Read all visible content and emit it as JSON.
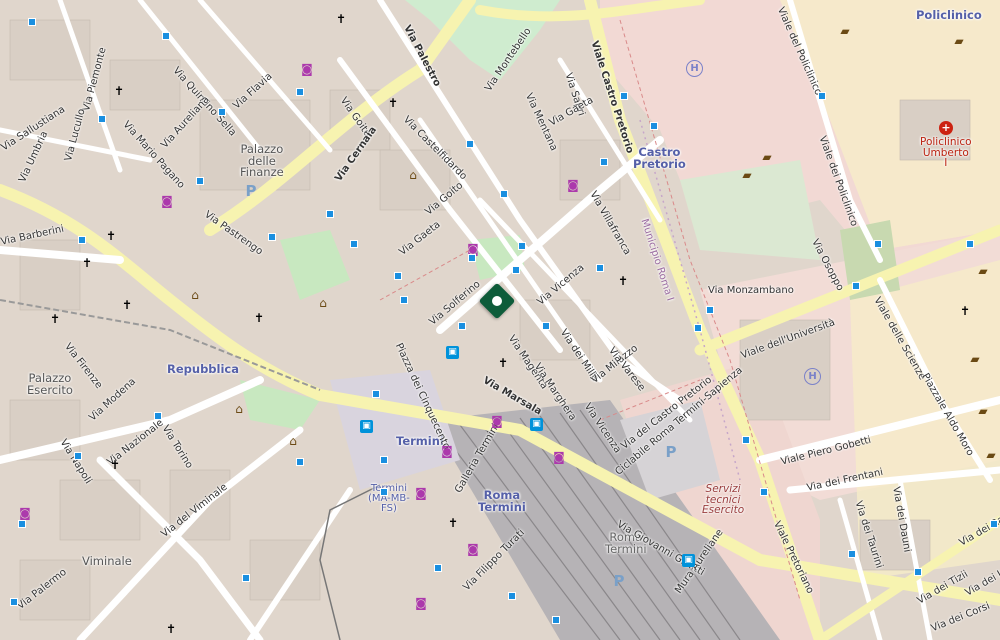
{
  "map": {
    "areas": [
      {
        "key": "policlinico",
        "label": "Policlinico"
      },
      {
        "key": "repubblica",
        "label": "Repubblica"
      },
      {
        "key": "termini_hub",
        "label": "Termini"
      },
      {
        "key": "roma_termini",
        "label": "Roma\nTermini"
      },
      {
        "key": "castro_pretorio",
        "label": "Castro\nPretorio"
      }
    ],
    "metro": {
      "termini": "Termini\n(MA-MB-\nFS)",
      "roma_termini_grey": "Roma\nTermini"
    },
    "places": {
      "palazzo_finanze": "Palazzo\ndelle\nFinanze",
      "palazzo_esercito": "Palazzo\nEsercito",
      "viminale": "Viminale",
      "policlinico_umberto": "Policlinico\nUmberto\nI",
      "servizi_tecnici": "Servizi\ntecnici\nEsercito"
    },
    "streets": [
      "Viale del Policlinico",
      "Viale dei Policlinico",
      "Via Palestro",
      "Via Montebello",
      "Via Mentana",
      "Via Sapri",
      "Viale Castro Pretorio",
      "Via Gaeta",
      "Via Goito",
      "Via Castelfidardo",
      "Via Cernaia",
      "Via Pastrengo",
      "Via Sallustiana",
      "Via Quintino Sella",
      "Via Flavia",
      "Via Aureliana",
      "Via Mario Pagano",
      "Via Piemonte",
      "Via Lucullo",
      "Via Umbria",
      "Via Barberini",
      "Via Firenze",
      "Via Modena",
      "Via Nazionale",
      "Via Napoli",
      "Via Torino",
      "Via del Viminale",
      "Via Palermo",
      "Via Solferino",
      "Piazza dei Cinquecento",
      "Via Magenta",
      "Via Marghera",
      "Via dei Mille",
      "Via Milazzo",
      "Via Varese",
      "Via Vicenza",
      "Via Villafranca",
      "Via Marsala",
      "Viale delle Scienze",
      "Via Monzambano",
      "Viale dell'Università",
      "Via Osoppo",
      "Viale Piero Gobetti",
      "Via dei Frentani",
      "Via dei Dauni",
      "Via dei Taurini",
      "Viale Pretoriano",
      "Via Filippo Turati",
      "Galleria Termini",
      "Piazzale Aldo Moro",
      "Via dei Tizii",
      "Via dei Lucani",
      "Via dei Ramni",
      "Via dei Corsi",
      "Via Giovanni Giolitti",
      "Mura Aureliane",
      "Municipio Roma I",
      "Via del Castro Pretorio",
      "Ciclabile Roma Termini-Sapienza",
      "Via Vicenza",
      "Via Goito",
      "Via Gaeta"
    ]
  }
}
